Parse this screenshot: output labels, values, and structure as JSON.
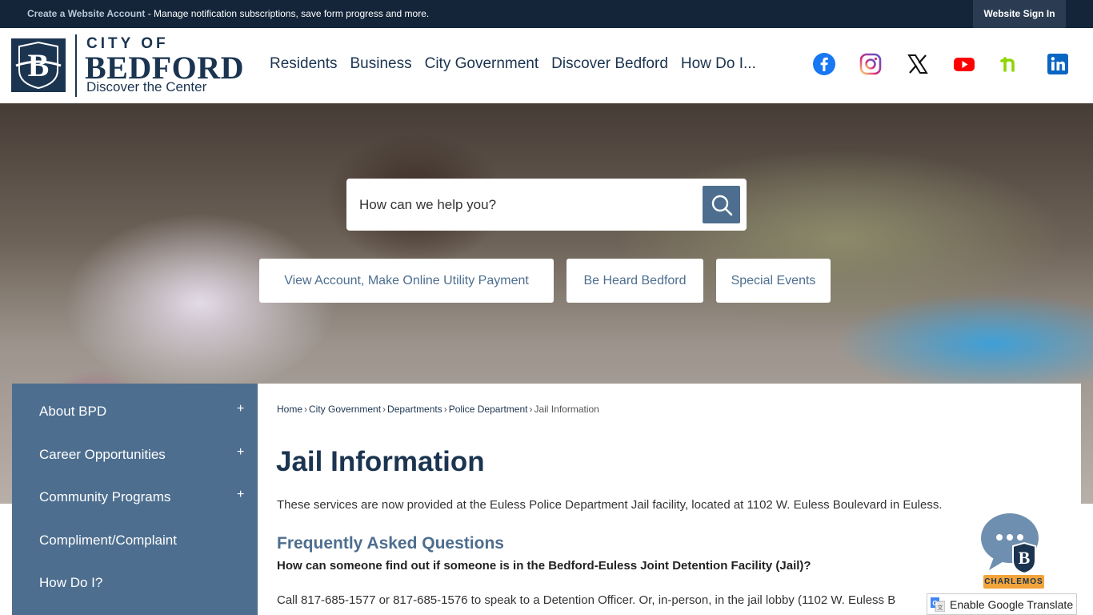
{
  "topbar": {
    "create_account_link": "Create a Website Account",
    "message": " - Manage notification subscriptions, save form progress and more.",
    "sign_in": "Website Sign In"
  },
  "logo": {
    "city": "CITY OF",
    "name": "BEDFORD",
    "tagline": "Discover the Center"
  },
  "nav": {
    "items": [
      "Residents",
      "Business",
      "City Government",
      "Discover Bedford",
      "How Do I..."
    ]
  },
  "social": [
    "facebook-icon",
    "instagram-icon",
    "x-icon",
    "youtube-icon",
    "nextdoor-icon",
    "linkedin-icon"
  ],
  "hero": {
    "search_placeholder": "How can we help you?",
    "quick_links": [
      "View Account, Make Online Utility Payment",
      "Be Heard Bedford",
      "Special Events"
    ]
  },
  "sidebar": {
    "items": [
      {
        "label": "About BPD",
        "expandable": "+"
      },
      {
        "label": "Career Opportunities",
        "expandable": "+"
      },
      {
        "label": "Community Programs",
        "expandable": "+"
      },
      {
        "label": "Compliment/Complaint"
      },
      {
        "label": "How Do I?"
      }
    ]
  },
  "breadcrumb": {
    "items": [
      "Home",
      "City Government",
      "Departments",
      "Police Department"
    ],
    "current": "Jail Information",
    "separator": "›"
  },
  "page": {
    "title": "Jail Information",
    "intro": "These services are now provided at the Euless Police Department Jail facility, located at 1102 W. Euless Boulevard in Euless.",
    "faq_heading": "Frequently Asked Questions",
    "faq_question": "How can someone find out if someone is in the Bedford-Euless Joint Detention Facility (Jail)?",
    "faq_answer": "Call 817-685-1577 or 817-685-1576 to speak to a Detention Officer. Or, in-person, in the jail lobby (1102 W. Euless B"
  },
  "chatbot": {
    "label": "CHARLEMOS"
  },
  "translate": {
    "label": "Enable Google Translate"
  },
  "colors": {
    "navy": "#1b3450",
    "slate": "#4d6e8f",
    "topbar": "#14253a",
    "accent": "#f2a43a"
  }
}
